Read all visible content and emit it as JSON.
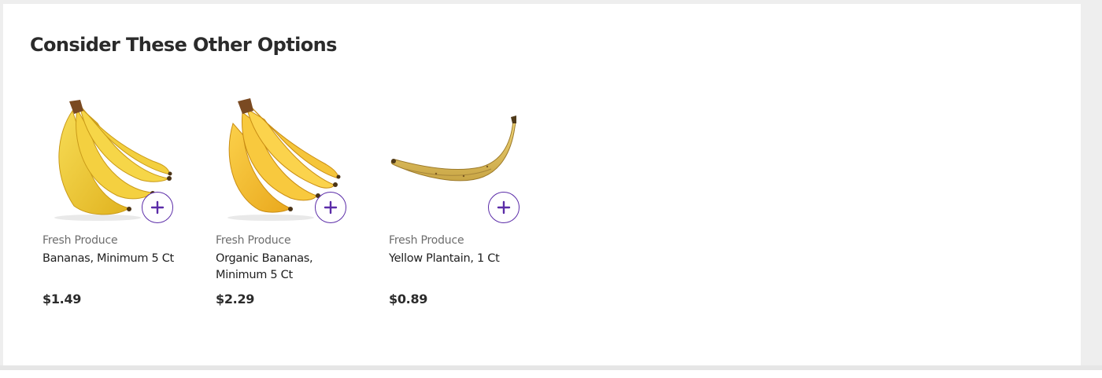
{
  "section": {
    "title": "Consider These Other Options"
  },
  "products": [
    {
      "category": "Fresh Produce",
      "name": "Bananas, Minimum 5 Ct",
      "price": "$1.49",
      "image": "bananas-bunch"
    },
    {
      "category": "Fresh Produce",
      "name": "Organic Bananas, Minimum 5 Ct",
      "price": "$2.29",
      "image": "organic-bananas-bunch"
    },
    {
      "category": "Fresh Produce",
      "name": "Yellow Plantain, 1 Ct",
      "price": "$0.89",
      "image": "plantain"
    }
  ],
  "colors": {
    "accent": "#5b2ca8",
    "banana_yellow": "#f2c832",
    "text_primary": "#1f1f1f",
    "text_secondary": "#6d6d6d"
  },
  "icons": {
    "add": "plus-icon"
  }
}
